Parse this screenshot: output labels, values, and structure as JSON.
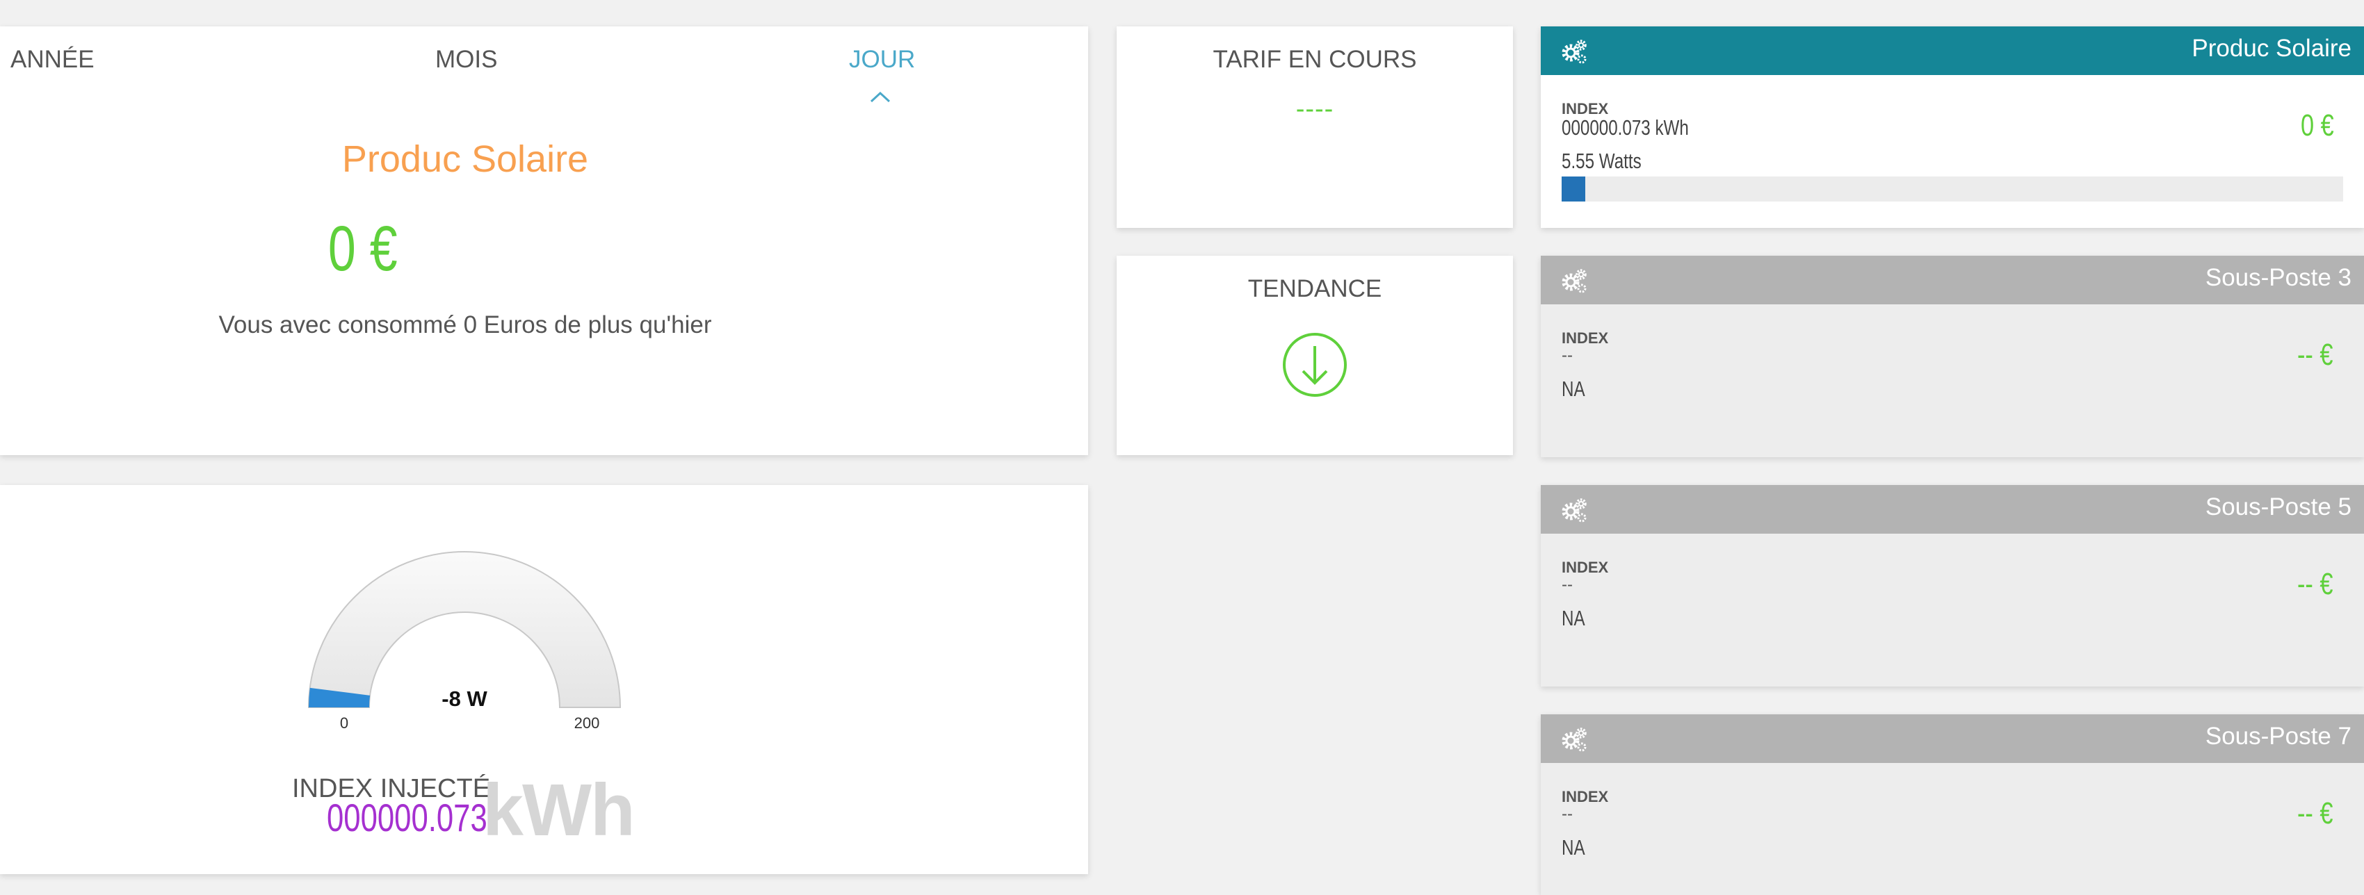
{
  "tabs": {
    "year": "ANNÉE",
    "month": "MOIS",
    "day": "JOUR"
  },
  "summary": {
    "title": "Produc Solaire",
    "amount": "0 €",
    "message": "Vous avec consommé 0 Euros de plus qu'hier"
  },
  "tarif": {
    "label": "TARIF EN COURS",
    "value": "----"
  },
  "tendance": {
    "label": "TENDANCE",
    "icon": "arrow-down-circle-icon"
  },
  "gauge": {
    "value_text": "-8 W",
    "value": -8,
    "min_label": "0",
    "max_label": "200",
    "min": 0,
    "max": 200
  },
  "index_injecte": {
    "label": "INDEX INJECTÉ",
    "value": "000000.073",
    "unit": "kWh"
  },
  "subposts": [
    {
      "title": "Produc Solaire",
      "index_label": "INDEX",
      "index_value": "000000.073 kWh",
      "power": "5.55 Watts",
      "amount": "0 €",
      "progress": 0.03
    },
    {
      "title": "Sous-Poste 3",
      "index_label": "INDEX",
      "index_value": "--",
      "power": "NA",
      "amount": "-- €"
    },
    {
      "title": "Sous-Poste 5",
      "index_label": "INDEX",
      "index_value": "--",
      "power": "NA",
      "amount": "-- €"
    },
    {
      "title": "Sous-Poste 7",
      "index_label": "INDEX",
      "index_value": "--",
      "power": "NA",
      "amount": "-- €"
    }
  ],
  "colors": {
    "active_tab": "#4aa8c9",
    "title_orange": "#f8a050",
    "green": "#5fd03b",
    "header_teal": "#158697",
    "header_grey": "#b3b3b3",
    "purple": "#a530d0",
    "gauge_fill": "#2d8ad6"
  }
}
